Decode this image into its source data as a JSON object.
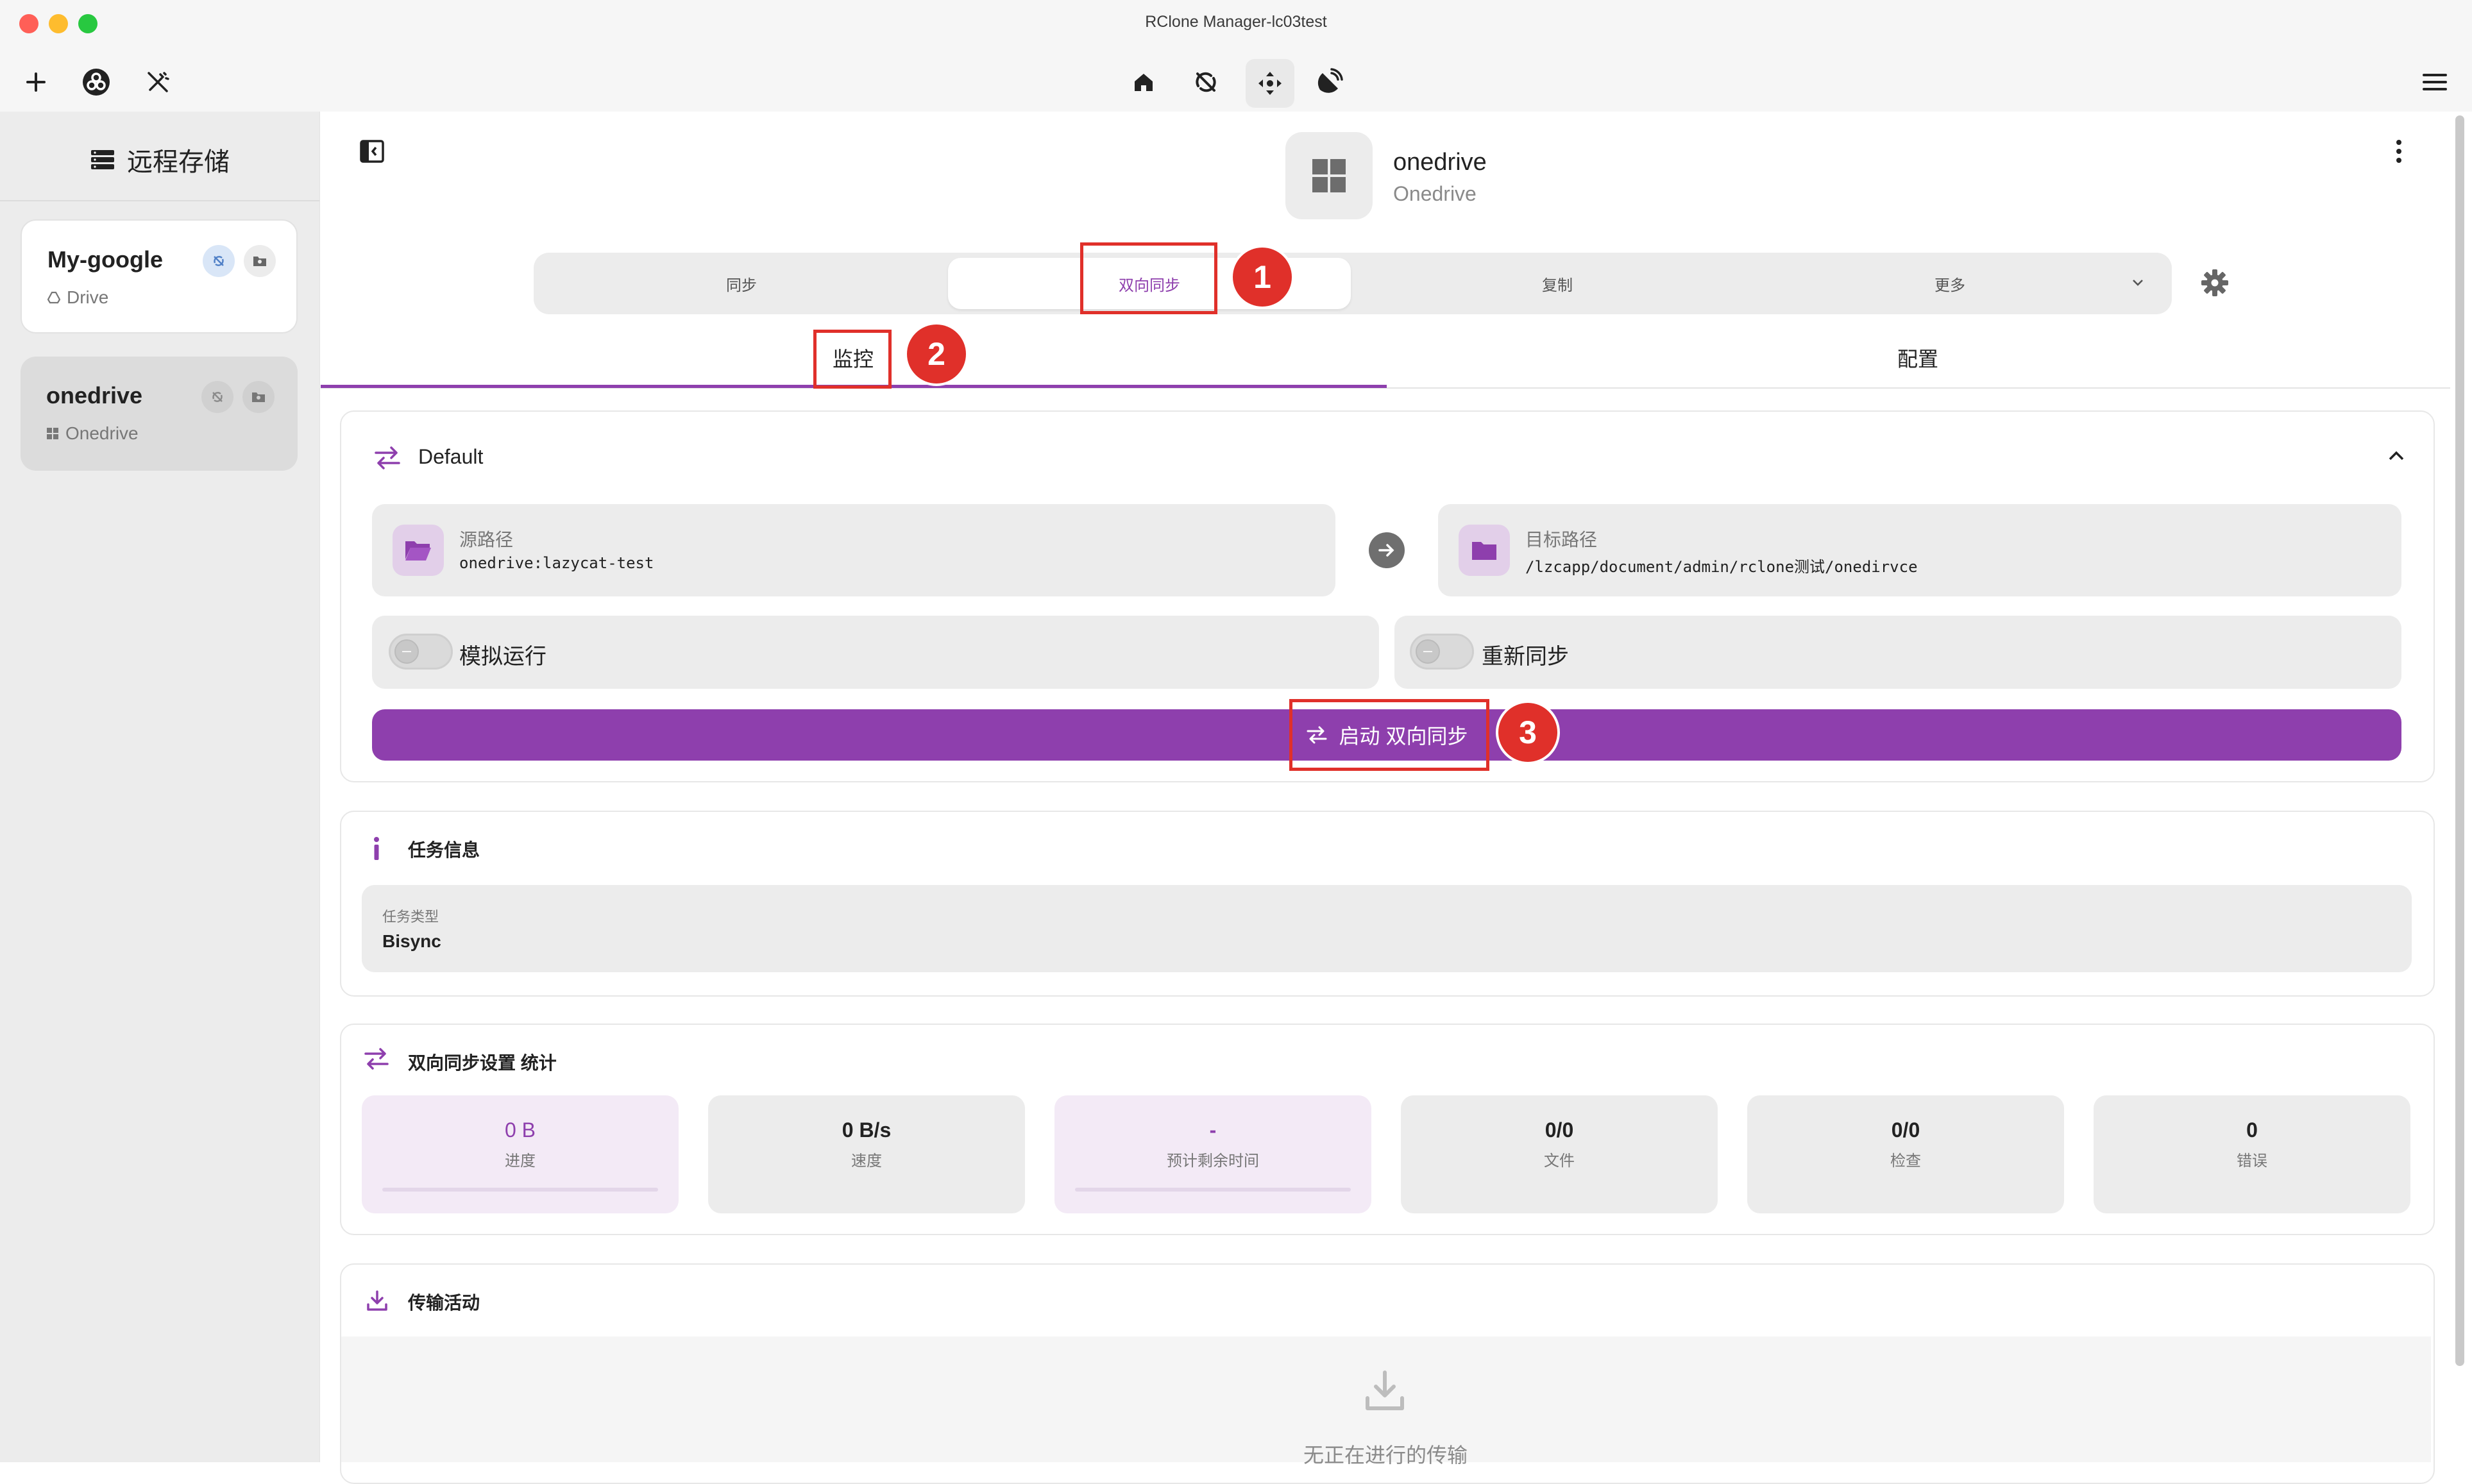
{
  "window": {
    "title": "RClone Manager-lc03test"
  },
  "toolbar": {
    "left_icons": [
      "plus-icon",
      "rclone-logo-icon",
      "wand-off-icon"
    ],
    "center_icons": [
      "home-icon",
      "sync-off-icon",
      "move-icon",
      "satellite-icon"
    ],
    "right_icon": "hamburger-menu-icon"
  },
  "sidebar": {
    "heading": "远程存储",
    "remotes": [
      {
        "name": "My-google",
        "type": "Drive"
      },
      {
        "name": "onedrive",
        "type": "Onedrive",
        "selected": true
      }
    ]
  },
  "header": {
    "name": "onedrive",
    "type": "Onedrive"
  },
  "op_tabs": {
    "items": [
      "同步",
      "双向同步",
      "复制",
      "更多"
    ],
    "active": "双向同步"
  },
  "view_tabs": {
    "items": [
      "监控",
      "配置"
    ],
    "active": "监控"
  },
  "job": {
    "profile": "Default",
    "source_label": "源路径",
    "source_path": "onedrive:lazycat-test",
    "dest_label": "目标路径",
    "dest_path": "/lzcapp/document/admin/rclone测试/onedirvce",
    "dry_run_label": "模拟运行",
    "resync_label": "重新同步",
    "start_label": "启动 双向同步"
  },
  "job_info": {
    "title": "任务信息",
    "field_label": "任务类型",
    "field_value": "Bisync"
  },
  "stats": {
    "title": "双向同步设置 统计",
    "items": [
      {
        "value": "0 B",
        "label": "进度"
      },
      {
        "value": "0 B/s",
        "label": "速度"
      },
      {
        "value": "-",
        "label": "预计剩余时间"
      },
      {
        "value": "0/0",
        "label": "文件"
      },
      {
        "value": "0/0",
        "label": "检查"
      },
      {
        "value": "0",
        "label": "错误"
      }
    ]
  },
  "transfers": {
    "title": "传输活动",
    "empty": "无正在进行的传输"
  },
  "annotations": [
    "1",
    "2",
    "3"
  ],
  "colors": {
    "accent": "#8e3fad",
    "annotation": "#e0302a"
  }
}
